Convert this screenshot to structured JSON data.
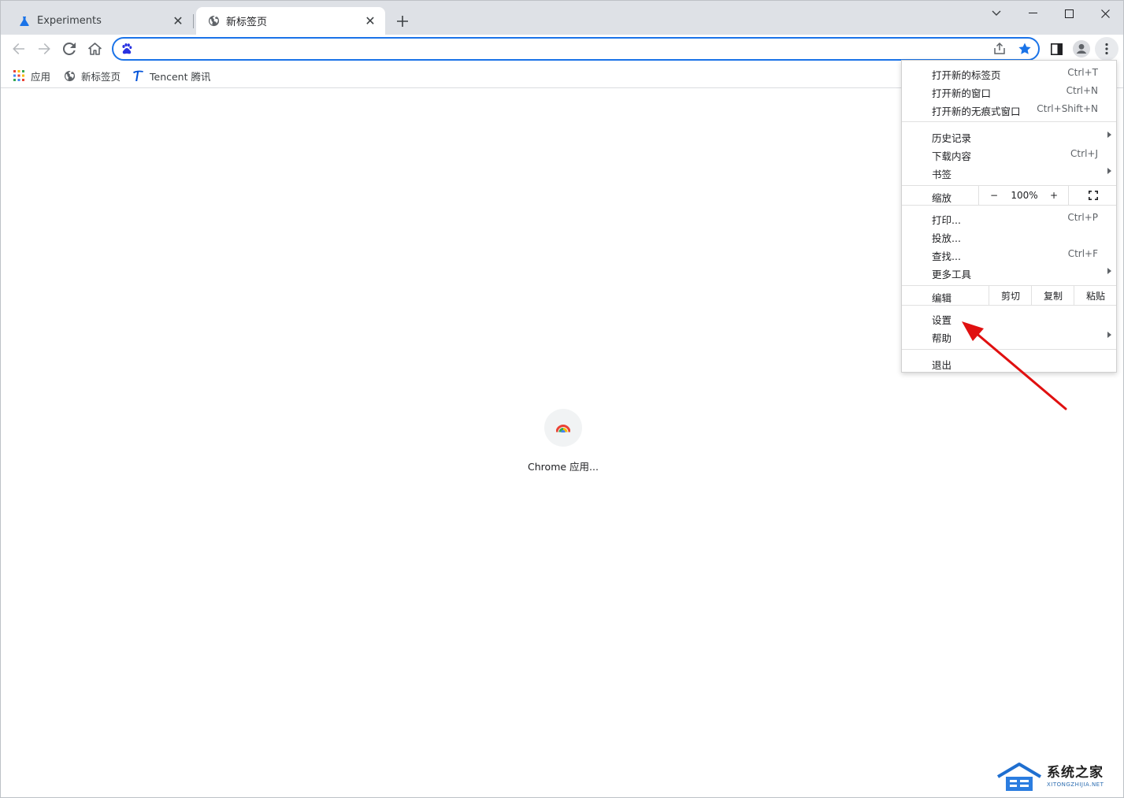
{
  "tabs": [
    {
      "title": "Experiments",
      "favicon": "flask-icon",
      "active": false
    },
    {
      "title": "新标签页",
      "favicon": "globe-icon",
      "active": true
    }
  ],
  "omnibox": {
    "value": "",
    "placeholder": "",
    "search_engine_icon": "baidu-paw-icon"
  },
  "bookmarks": [
    {
      "label": "应用",
      "icon": "apps-grid-icon"
    },
    {
      "label": "新标签页",
      "icon": "globe-icon"
    },
    {
      "label": "Tencent 腾讯",
      "icon": "tencent-icon"
    }
  ],
  "shortcut": {
    "label": "Chrome 应用..."
  },
  "menu": {
    "group1": [
      {
        "label": "打开新的标签页",
        "shortcut": "Ctrl+T"
      },
      {
        "label": "打开新的窗口",
        "shortcut": "Ctrl+N"
      },
      {
        "label": "打开新的无痕式窗口",
        "shortcut": "Ctrl+Shift+N"
      }
    ],
    "group2": [
      {
        "label": "历史记录",
        "submenu": true
      },
      {
        "label": "下载内容",
        "shortcut": "Ctrl+J"
      },
      {
        "label": "书签",
        "submenu": true
      }
    ],
    "zoom": {
      "label": "缩放",
      "minus": "−",
      "value": "100%",
      "plus": "+"
    },
    "group3": [
      {
        "label": "打印...",
        "shortcut": "Ctrl+P"
      },
      {
        "label": "投放..."
      },
      {
        "label": "查找...",
        "shortcut": "Ctrl+F"
      },
      {
        "label": "更多工具",
        "submenu": true
      }
    ],
    "edit": {
      "label": "编辑",
      "cut": "剪切",
      "copy": "复制",
      "paste": "粘贴"
    },
    "group4": [
      {
        "label": "设置"
      },
      {
        "label": "帮助",
        "submenu": true
      }
    ],
    "exit": {
      "label": "退出"
    }
  },
  "watermark": {
    "title": "系统之家",
    "url": "XITONGZHIJIA.NET"
  },
  "colors": {
    "accent": "#1a73e8",
    "annotation_arrow": "#e01010",
    "tabstrip": "#dee1e6"
  }
}
